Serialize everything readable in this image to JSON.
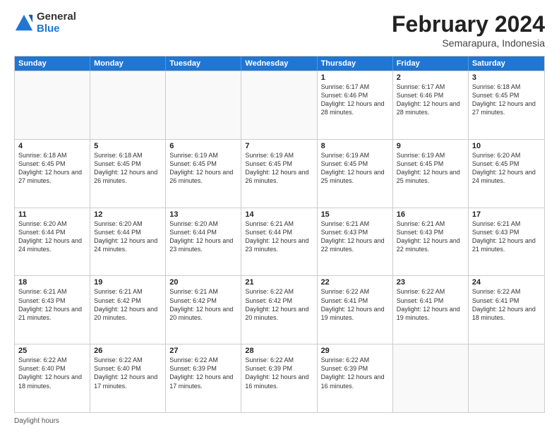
{
  "logo": {
    "general": "General",
    "blue": "Blue"
  },
  "title": {
    "month": "February 2024",
    "location": "Semarapura, Indonesia"
  },
  "header": {
    "days": [
      "Sunday",
      "Monday",
      "Tuesday",
      "Wednesday",
      "Thursday",
      "Friday",
      "Saturday"
    ]
  },
  "footer": {
    "daylight_label": "Daylight hours"
  },
  "weeks": [
    [
      {
        "day": "",
        "info": ""
      },
      {
        "day": "",
        "info": ""
      },
      {
        "day": "",
        "info": ""
      },
      {
        "day": "",
        "info": ""
      },
      {
        "day": "1",
        "info": "Sunrise: 6:17 AM\nSunset: 6:46 PM\nDaylight: 12 hours and 28 minutes."
      },
      {
        "day": "2",
        "info": "Sunrise: 6:17 AM\nSunset: 6:46 PM\nDaylight: 12 hours and 28 minutes."
      },
      {
        "day": "3",
        "info": "Sunrise: 6:18 AM\nSunset: 6:45 PM\nDaylight: 12 hours and 27 minutes."
      }
    ],
    [
      {
        "day": "4",
        "info": "Sunrise: 6:18 AM\nSunset: 6:45 PM\nDaylight: 12 hours and 27 minutes."
      },
      {
        "day": "5",
        "info": "Sunrise: 6:18 AM\nSunset: 6:45 PM\nDaylight: 12 hours and 26 minutes."
      },
      {
        "day": "6",
        "info": "Sunrise: 6:19 AM\nSunset: 6:45 PM\nDaylight: 12 hours and 26 minutes."
      },
      {
        "day": "7",
        "info": "Sunrise: 6:19 AM\nSunset: 6:45 PM\nDaylight: 12 hours and 26 minutes."
      },
      {
        "day": "8",
        "info": "Sunrise: 6:19 AM\nSunset: 6:45 PM\nDaylight: 12 hours and 25 minutes."
      },
      {
        "day": "9",
        "info": "Sunrise: 6:19 AM\nSunset: 6:45 PM\nDaylight: 12 hours and 25 minutes."
      },
      {
        "day": "10",
        "info": "Sunrise: 6:20 AM\nSunset: 6:45 PM\nDaylight: 12 hours and 24 minutes."
      }
    ],
    [
      {
        "day": "11",
        "info": "Sunrise: 6:20 AM\nSunset: 6:44 PM\nDaylight: 12 hours and 24 minutes."
      },
      {
        "day": "12",
        "info": "Sunrise: 6:20 AM\nSunset: 6:44 PM\nDaylight: 12 hours and 24 minutes."
      },
      {
        "day": "13",
        "info": "Sunrise: 6:20 AM\nSunset: 6:44 PM\nDaylight: 12 hours and 23 minutes."
      },
      {
        "day": "14",
        "info": "Sunrise: 6:21 AM\nSunset: 6:44 PM\nDaylight: 12 hours and 23 minutes."
      },
      {
        "day": "15",
        "info": "Sunrise: 6:21 AM\nSunset: 6:43 PM\nDaylight: 12 hours and 22 minutes."
      },
      {
        "day": "16",
        "info": "Sunrise: 6:21 AM\nSunset: 6:43 PM\nDaylight: 12 hours and 22 minutes."
      },
      {
        "day": "17",
        "info": "Sunrise: 6:21 AM\nSunset: 6:43 PM\nDaylight: 12 hours and 21 minutes."
      }
    ],
    [
      {
        "day": "18",
        "info": "Sunrise: 6:21 AM\nSunset: 6:43 PM\nDaylight: 12 hours and 21 minutes."
      },
      {
        "day": "19",
        "info": "Sunrise: 6:21 AM\nSunset: 6:42 PM\nDaylight: 12 hours and 20 minutes."
      },
      {
        "day": "20",
        "info": "Sunrise: 6:21 AM\nSunset: 6:42 PM\nDaylight: 12 hours and 20 minutes."
      },
      {
        "day": "21",
        "info": "Sunrise: 6:22 AM\nSunset: 6:42 PM\nDaylight: 12 hours and 20 minutes."
      },
      {
        "day": "22",
        "info": "Sunrise: 6:22 AM\nSunset: 6:41 PM\nDaylight: 12 hours and 19 minutes."
      },
      {
        "day": "23",
        "info": "Sunrise: 6:22 AM\nSunset: 6:41 PM\nDaylight: 12 hours and 19 minutes."
      },
      {
        "day": "24",
        "info": "Sunrise: 6:22 AM\nSunset: 6:41 PM\nDaylight: 12 hours and 18 minutes."
      }
    ],
    [
      {
        "day": "25",
        "info": "Sunrise: 6:22 AM\nSunset: 6:40 PM\nDaylight: 12 hours and 18 minutes."
      },
      {
        "day": "26",
        "info": "Sunrise: 6:22 AM\nSunset: 6:40 PM\nDaylight: 12 hours and 17 minutes."
      },
      {
        "day": "27",
        "info": "Sunrise: 6:22 AM\nSunset: 6:39 PM\nDaylight: 12 hours and 17 minutes."
      },
      {
        "day": "28",
        "info": "Sunrise: 6:22 AM\nSunset: 6:39 PM\nDaylight: 12 hours and 16 minutes."
      },
      {
        "day": "29",
        "info": "Sunrise: 6:22 AM\nSunset: 6:39 PM\nDaylight: 12 hours and 16 minutes."
      },
      {
        "day": "",
        "info": ""
      },
      {
        "day": "",
        "info": ""
      }
    ]
  ]
}
